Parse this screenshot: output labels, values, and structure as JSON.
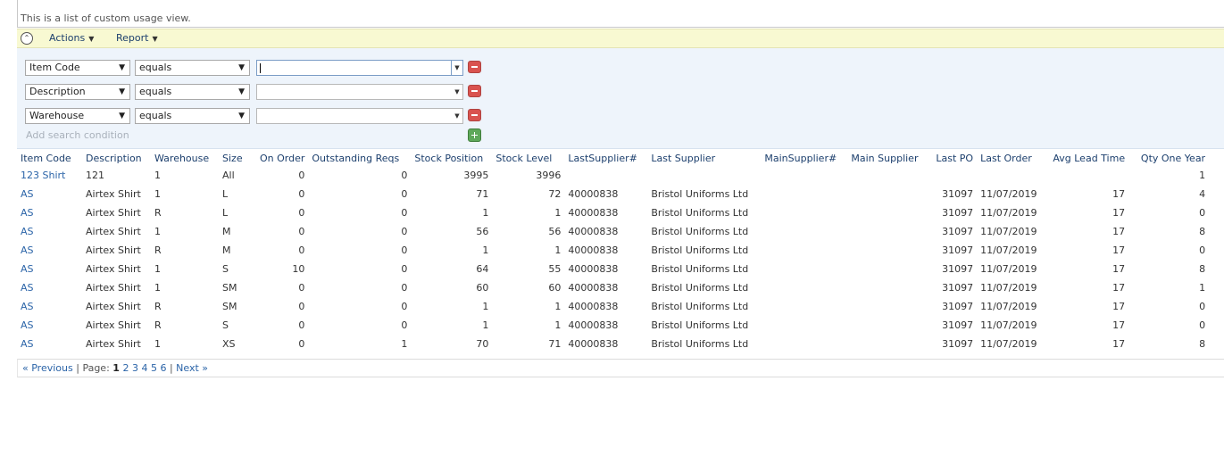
{
  "description": "This is a list of custom usage view.",
  "toolbar": {
    "actions_label": "Actions",
    "report_label": "Report"
  },
  "filters": [
    {
      "field": "Item Code",
      "operator": "equals",
      "value": ""
    },
    {
      "field": "Description",
      "operator": "equals",
      "value": ""
    },
    {
      "field": "Warehouse",
      "operator": "equals",
      "value": ""
    }
  ],
  "add_condition_label": "Add search condition",
  "columns": [
    "Item Code",
    "Description",
    "Warehouse",
    "Size",
    "On Order",
    "Outstanding Reqs",
    "Stock Position",
    "Stock Level",
    "LastSupplier#",
    "Last Supplier",
    "MainSupplier#",
    "Main Supplier",
    "Last PO",
    "Last Order",
    "Avg Lead Time",
    "Qty One Year"
  ],
  "rows": [
    [
      "123 Shirt",
      "121",
      "1",
      "All",
      "0",
      "0",
      "3995",
      "3996",
      "",
      "",
      "",
      "",
      "",
      "",
      "",
      "1"
    ],
    [
      "AS",
      "Airtex Shirt",
      "1",
      "L",
      "0",
      "0",
      "71",
      "72",
      "40000838",
      "Bristol Uniforms Ltd",
      "",
      "",
      "31097",
      "11/07/2019",
      "17",
      "4"
    ],
    [
      "AS",
      "Airtex Shirt",
      "R",
      "L",
      "0",
      "0",
      "1",
      "1",
      "40000838",
      "Bristol Uniforms Ltd",
      "",
      "",
      "31097",
      "11/07/2019",
      "17",
      "0"
    ],
    [
      "AS",
      "Airtex Shirt",
      "1",
      "M",
      "0",
      "0",
      "56",
      "56",
      "40000838",
      "Bristol Uniforms Ltd",
      "",
      "",
      "31097",
      "11/07/2019",
      "17",
      "8"
    ],
    [
      "AS",
      "Airtex Shirt",
      "R",
      "M",
      "0",
      "0",
      "1",
      "1",
      "40000838",
      "Bristol Uniforms Ltd",
      "",
      "",
      "31097",
      "11/07/2019",
      "17",
      "0"
    ],
    [
      "AS",
      "Airtex Shirt",
      "1",
      "S",
      "10",
      "0",
      "64",
      "55",
      "40000838",
      "Bristol Uniforms Ltd",
      "",
      "",
      "31097",
      "11/07/2019",
      "17",
      "8"
    ],
    [
      "AS",
      "Airtex Shirt",
      "1",
      "SM",
      "0",
      "0",
      "60",
      "60",
      "40000838",
      "Bristol Uniforms Ltd",
      "",
      "",
      "31097",
      "11/07/2019",
      "17",
      "1"
    ],
    [
      "AS",
      "Airtex Shirt",
      "R",
      "SM",
      "0",
      "0",
      "1",
      "1",
      "40000838",
      "Bristol Uniforms Ltd",
      "",
      "",
      "31097",
      "11/07/2019",
      "17",
      "0"
    ],
    [
      "AS",
      "Airtex Shirt",
      "R",
      "S",
      "0",
      "0",
      "1",
      "1",
      "40000838",
      "Bristol Uniforms Ltd",
      "",
      "",
      "31097",
      "11/07/2019",
      "17",
      "0"
    ],
    [
      "AS",
      "Airtex Shirt",
      "1",
      "XS",
      "0",
      "1",
      "70",
      "71",
      "40000838",
      "Bristol Uniforms Ltd",
      "",
      "",
      "31097",
      "11/07/2019",
      "17",
      "8"
    ]
  ],
  "pager": {
    "previous_label": "« Previous",
    "page_label": "Page:",
    "current_page": "1",
    "pages": [
      "2",
      "3",
      "4",
      "5",
      "6"
    ],
    "separator": "|",
    "next_label": "Next »"
  }
}
